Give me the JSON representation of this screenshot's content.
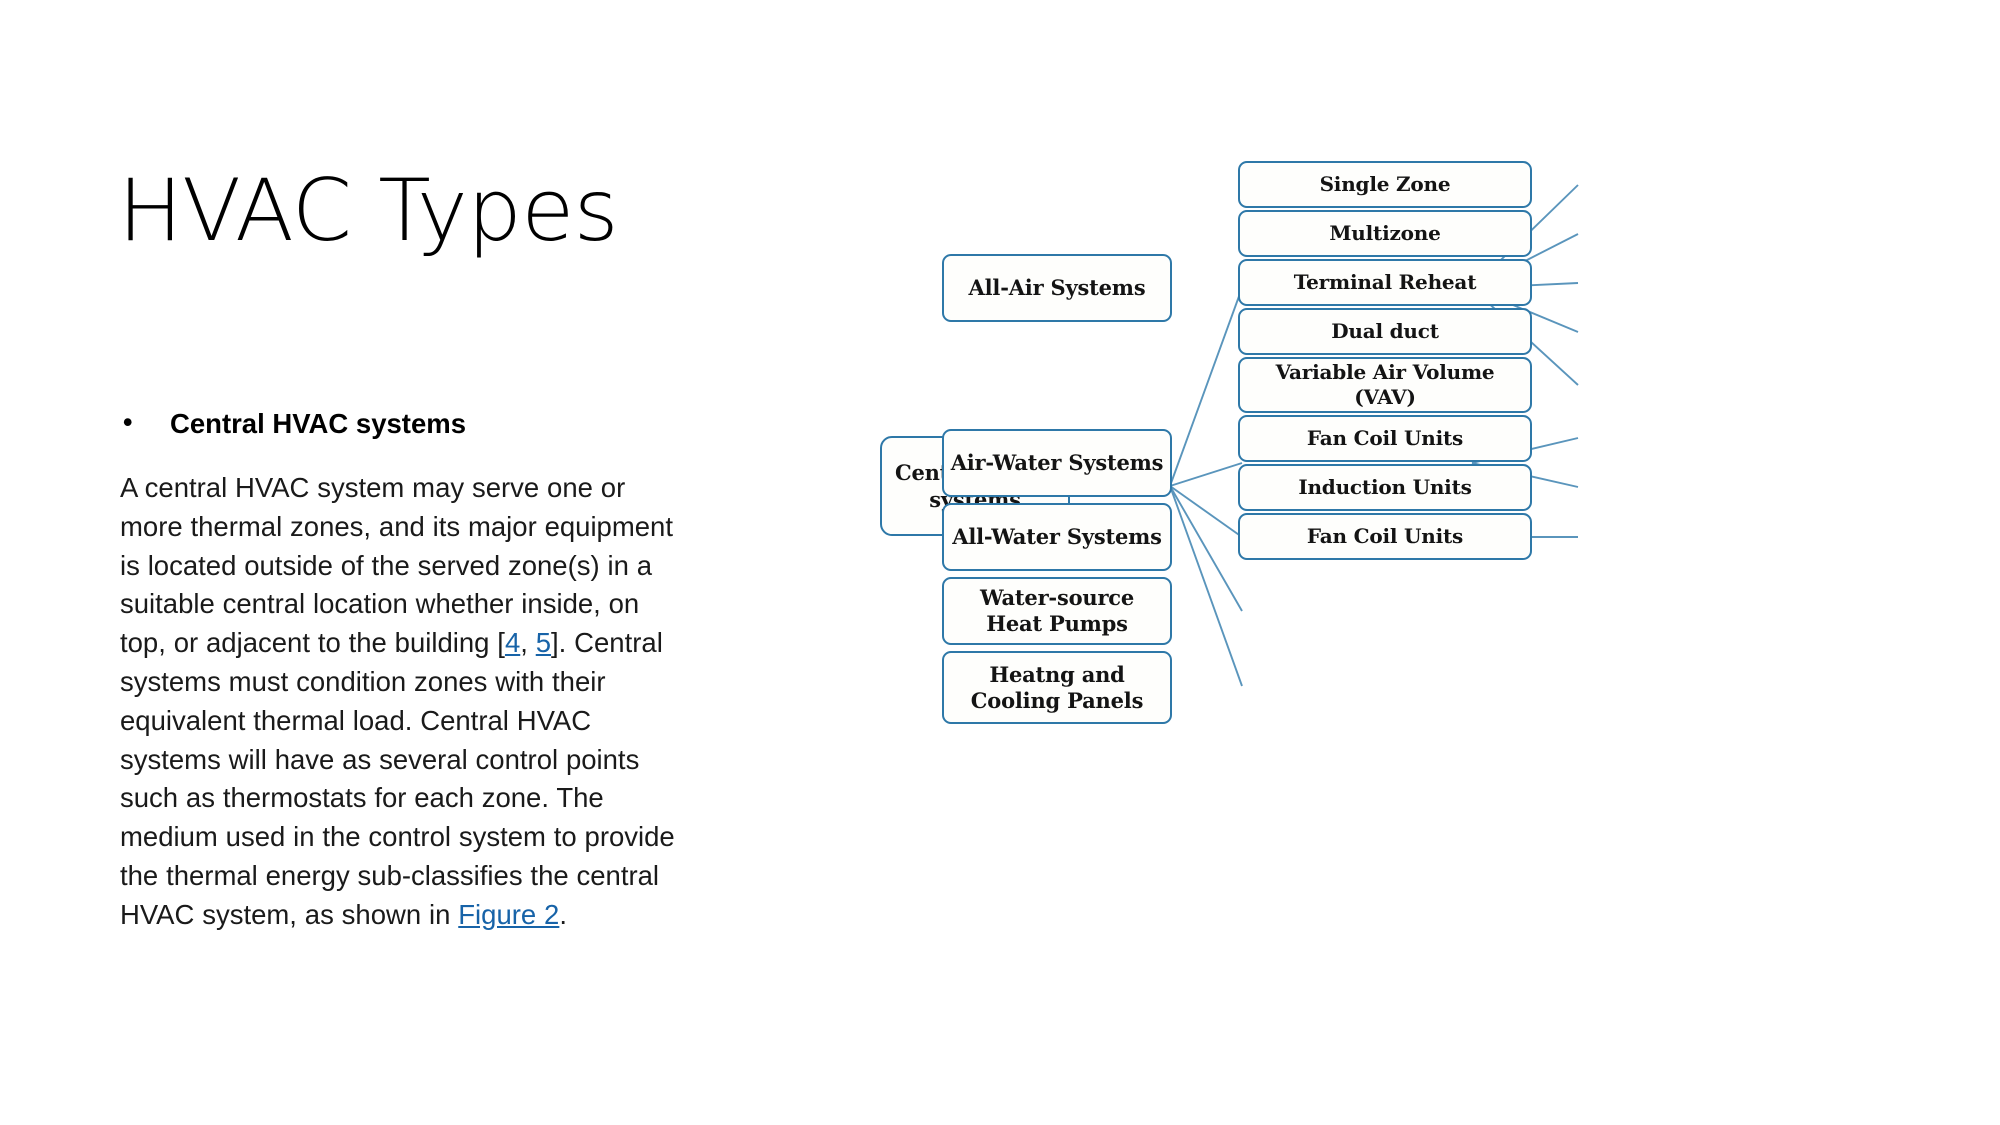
{
  "slide": {
    "title": "HVAC Types",
    "bullet": {
      "marker": "•",
      "label": "Central HVAC systems"
    },
    "paragraph": {
      "part1": "A central HVAC system may serve one or more thermal zones, and its major equipment is located outside of the served zone(s) in a suitable central location whether inside, on top, or adjacent to the building [",
      "link_ref_4": "4",
      "sep": ", ",
      "link_ref_5": "5",
      "part2": "]. Central systems must condition zones with their equivalent thermal load. Central HVAC systems will have as several control points such as thermostats for each zone. The medium used in the control system to provide the thermal energy sub-classifies the central HVAC system, as shown in ",
      "link_figure": "Figure 2",
      "part3": "."
    }
  },
  "colors": {
    "node_border": "#2E78A8",
    "node_fill": "#FEFEFC",
    "edge": "#5A95BC",
    "link": "#1763A8",
    "text": "#000000"
  },
  "diagram": {
    "root": {
      "label": "Central HVAC systems"
    },
    "branches": [
      {
        "label": "All-Air Systems",
        "children": [
          {
            "label": "Single Zone"
          },
          {
            "label": "Multizone"
          },
          {
            "label": "Terminal Reheat"
          },
          {
            "label": "Dual duct"
          },
          {
            "label": "Variable Air Volume (VAV)"
          }
        ]
      },
      {
        "label": "Air-Water Systems",
        "children": [
          {
            "label": "Fan Coil Units"
          },
          {
            "label": "Induction Units"
          }
        ]
      },
      {
        "label": "All-Water Systems",
        "children": [
          {
            "label": "Fan Coil Units"
          }
        ]
      },
      {
        "label": "Water-source Heat Pumps",
        "children": []
      },
      {
        "label": "Heatng and Cooling Panels",
        "children": []
      }
    ]
  }
}
